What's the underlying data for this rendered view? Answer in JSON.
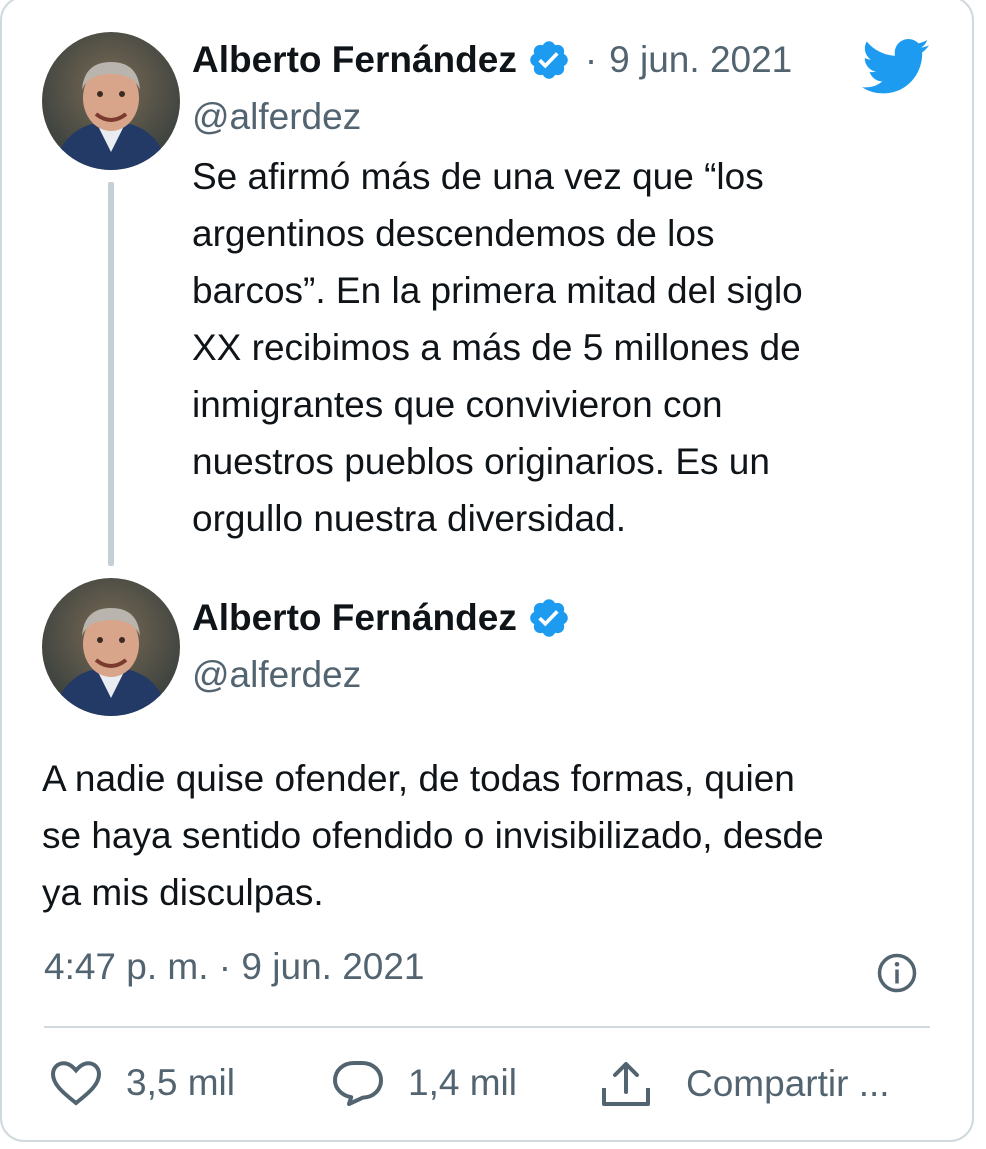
{
  "thread": {
    "first_tweet": {
      "author_name": "Alberto Fernández",
      "separator": "·",
      "date": "9 jun. 2021",
      "handle": "@alferdez",
      "text": "Se afirmó más de una vez que “los\nargentinos descendemos de los\nbarcos”. En la primera mitad del siglo\nXX recibimos a más de 5 millones de\ninmigrantes que convivieron con\nnuestros pueblos originarios. Es un\norgullo nuestra diversidad."
    },
    "main_tweet": {
      "author_name": "Alberto Fernández",
      "handle": "@alferdez",
      "text": "A nadie quise ofender, de todas formas, quien\nse haya sentido ofendido o invisibilizado, desde\nya mis disculpas.",
      "timestamp": "4:47 p. m. · 9 jun. 2021"
    }
  },
  "actions": {
    "like_count": "3,5 mil",
    "reply_count": "1,4 mil",
    "share_label": "Compartir ..."
  },
  "icons": {
    "verified": "verified-badge-icon",
    "brand": "twitter-bird-icon",
    "info": "info-icon",
    "like": "heart-icon",
    "reply": "reply-bubble-icon",
    "share": "share-icon"
  },
  "colors": {
    "accent": "#1d9bf0",
    "text": "#0f1419",
    "secondary": "#536471",
    "border": "#cfd9de"
  }
}
